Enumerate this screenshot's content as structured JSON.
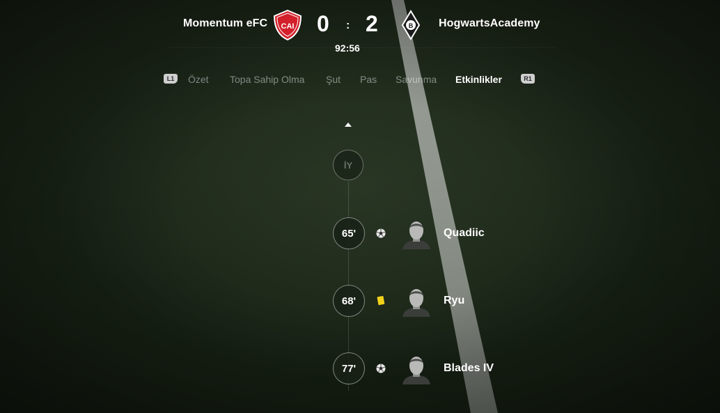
{
  "scoreboard": {
    "home_team": "Momentum eFC",
    "away_team": "HogwartsAcademy",
    "home_score": "0",
    "separator": ":",
    "away_score": "2",
    "match_clock": "92:56",
    "home_crest_color": "#d3202a",
    "away_crest_color": "#ffffff"
  },
  "tabs": {
    "left_bumper": "L1",
    "right_bumper": "R1",
    "items": [
      {
        "label": "Özet",
        "active": false
      },
      {
        "label": "Topa Sahip Olma",
        "active": false
      },
      {
        "label": "Şut",
        "active": false
      },
      {
        "label": "Pas",
        "active": false
      },
      {
        "label": "Savunma",
        "active": false
      },
      {
        "label": "Etkinlikler",
        "active": true
      }
    ]
  },
  "timeline": {
    "half_marker": "İY",
    "events": [
      {
        "minute": "65'",
        "type": "goal",
        "icon": "ball-icon",
        "player": "Quadiic"
      },
      {
        "minute": "68'",
        "type": "yellow-card",
        "icon": "yellow-card-icon",
        "player": "Ryu"
      },
      {
        "minute": "77'",
        "type": "goal",
        "icon": "ball-icon",
        "player": "Blades IV"
      }
    ]
  },
  "colors": {
    "yellow_card": "#f2d21b",
    "pitch": "#1b2618"
  }
}
